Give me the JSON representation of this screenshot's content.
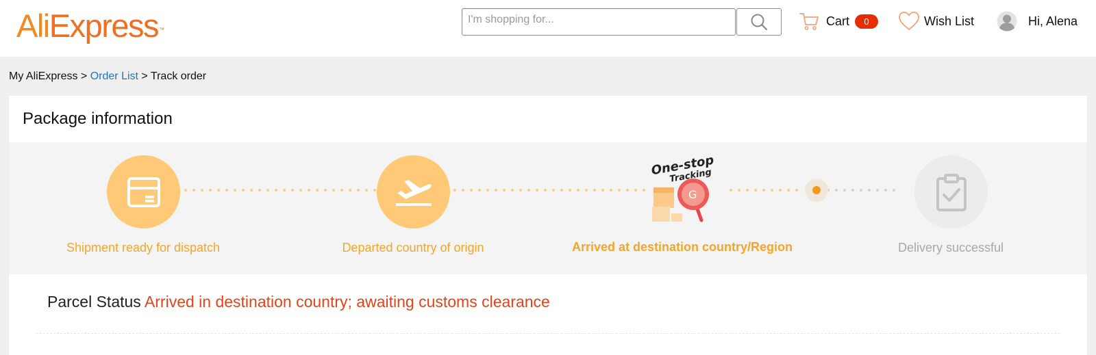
{
  "header": {
    "logo_ali": "Ali",
    "logo_express": "Express",
    "logo_tm": "™",
    "search_placeholder": "I'm shopping for...",
    "cart_label": "Cart",
    "cart_count": "0",
    "wishlist_label": "Wish List",
    "greeting": "Hi, Alena"
  },
  "breadcrumb": {
    "root": "My AliExpress",
    "separator": ">",
    "order_list": "Order List",
    "current": "Track order"
  },
  "package": {
    "title": "Package information",
    "steps": [
      {
        "label": "Shipment ready for dispatch",
        "state": "done",
        "icon": "package-icon"
      },
      {
        "label": "Departed country of origin",
        "state": "done",
        "icon": "plane-departure-icon"
      },
      {
        "label": "Arrived at destination country/Region",
        "state": "current",
        "icon": "one-stop-tracking-icon"
      },
      {
        "label": "Delivery successful",
        "state": "todo",
        "icon": "clipboard-check-icon"
      }
    ],
    "tracking_badge_line1": "One-stop",
    "tracking_badge_line2": "Tracking",
    "parcel_status_label": "Parcel Status",
    "parcel_status_value": "Arrived in destination country; awaiting customs clearance"
  },
  "colors": {
    "brand_orange": "#f26f21",
    "step_done": "#ffc977",
    "step_current_text": "#f4a62a",
    "status_red": "#e4431c",
    "link_blue": "#1a78c2",
    "cart_badge": "#e62e04"
  }
}
